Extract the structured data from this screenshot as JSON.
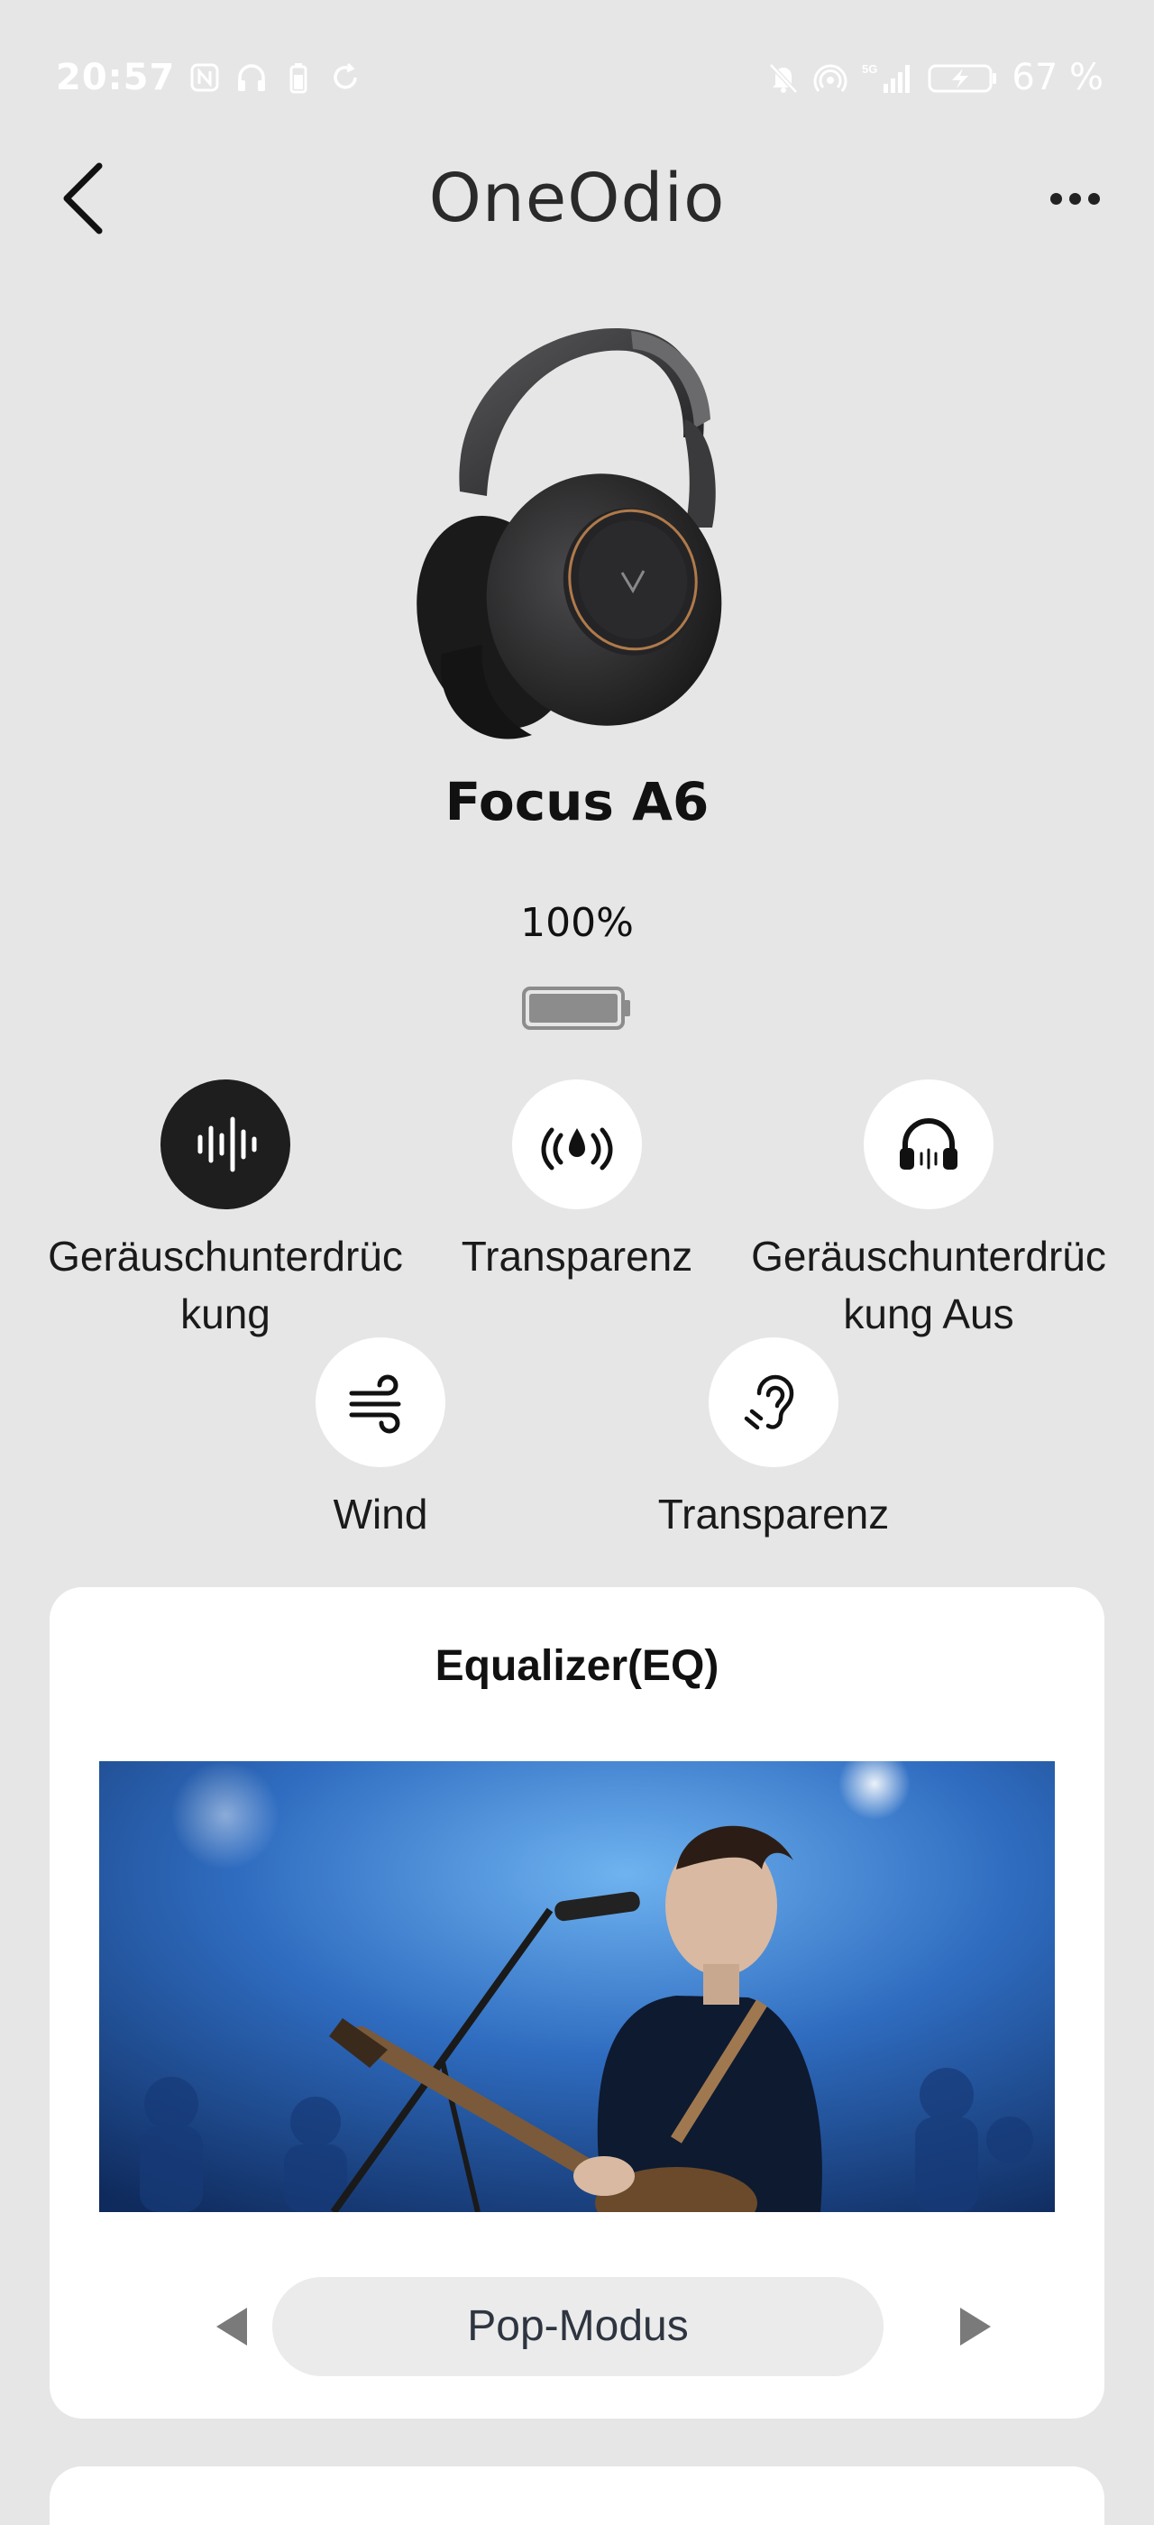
{
  "status_bar": {
    "time": "20:57",
    "battery_text": "67 %",
    "network": "5G",
    "left_icons": [
      "nfc-icon",
      "headphones-icon",
      "battery-small-icon",
      "sync-icon"
    ],
    "right_icons": [
      "mute-icon",
      "hotspot-icon",
      "signal-icon",
      "battery-charging-icon"
    ]
  },
  "header": {
    "title": "OneOdio",
    "back_icon": "chevron-left-icon",
    "more_icon": "more-horizontal-icon"
  },
  "device": {
    "name": "Focus A6",
    "battery_percent": "100%",
    "battery_level": 1.0
  },
  "modes": [
    {
      "label": "Geräuschunterdrückung",
      "icon": "soundwave-icon",
      "active": true
    },
    {
      "label": "Transparenz",
      "icon": "ambient-sound-icon",
      "active": false
    },
    {
      "label": "Geräuschunterdrückung Aus",
      "icon": "headphones-icon",
      "active": false
    },
    {
      "label": "Wind",
      "icon": "wind-icon",
      "active": false
    },
    {
      "label": "Transparenz",
      "icon": "ear-icon",
      "active": false
    }
  ],
  "equalizer": {
    "title": "Equalizer(EQ)",
    "mode": "Pop-Modus",
    "image": "singer-with-guitar-on-stage"
  },
  "colors": {
    "background": "#e6e6e6",
    "card": "#ffffff",
    "active_mode": "#1e1e1e",
    "text": "#111111"
  }
}
